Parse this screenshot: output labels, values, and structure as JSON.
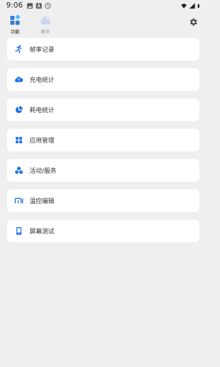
{
  "status_bar": {
    "time": "9:06"
  },
  "top_nav": {
    "tabs": [
      {
        "label": "功能",
        "active": true
      },
      {
        "label": "概览",
        "active": false
      }
    ],
    "settings_icon": "gear-icon"
  },
  "menu": {
    "items": [
      {
        "label": "帧率记录",
        "icon": "running-man-icon"
      },
      {
        "label": "充电统计",
        "icon": "cloud-icon"
      },
      {
        "label": "耗电统计",
        "icon": "pie-chart-icon"
      },
      {
        "label": "应用管理",
        "icon": "grid-icon"
      },
      {
        "label": "活动/服务",
        "icon": "cluster-icon"
      },
      {
        "label": "温控编辑",
        "icon": "mi-logo-icon"
      },
      {
        "label": "屏幕测试",
        "icon": "phone-screen-icon"
      }
    ]
  },
  "colors": {
    "accent": "#1e73e8",
    "background": "#efefef",
    "card": "#ffffff"
  }
}
